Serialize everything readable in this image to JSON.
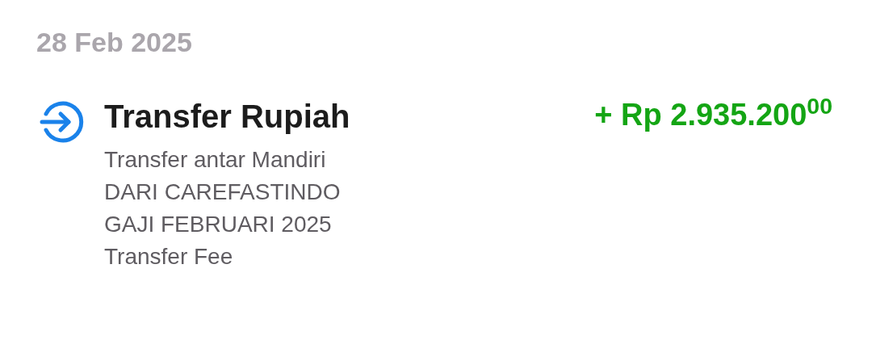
{
  "date": "28 Feb 2025",
  "transaction": {
    "title": "Transfer Rupiah",
    "kind": "credit",
    "amount": "+ Rp 2.935.200$^{00}$",
    "details": [
      "Transfer antar Mandiri",
      "DARI CAREFASTINDO",
      "GAJI FEBRUARI 2025",
      "Transfer Fee"
    ]
  }
}
